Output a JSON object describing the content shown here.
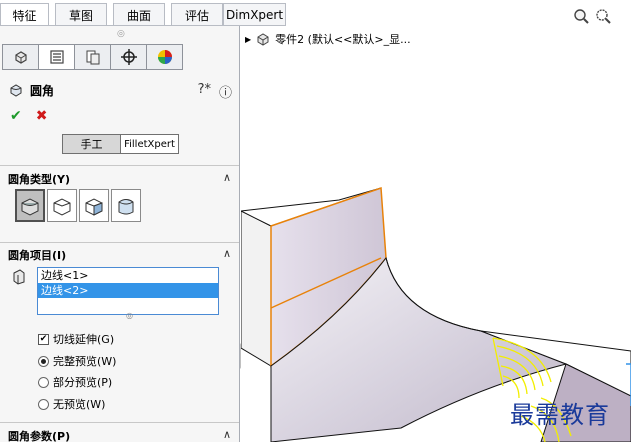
{
  "top_tabs": [
    "特征",
    "草图",
    "曲面",
    "评估",
    "DimXpert"
  ],
  "manager_tabs": [
    {
      "icon": "feature-manager-icon"
    },
    {
      "icon": "property-manager-icon"
    },
    {
      "icon": "configuration-manager-icon"
    },
    {
      "icon": "dimxpert-manager-icon"
    },
    {
      "icon": "display-manager-icon"
    }
  ],
  "pm": {
    "title": "圆角",
    "help_icons": [
      "detailed-help-icon",
      "help-icon"
    ]
  },
  "mode": {
    "manual": "手工",
    "xpert": "FilletXpert"
  },
  "sections": {
    "fillet_type": "圆角类型(Y)",
    "fillet_items": "圆角项目(I)",
    "fillet_params": "圆角参数(P)"
  },
  "edges": [
    "边线<1>",
    "边线<2>"
  ],
  "selected_edge_index": 1,
  "tangent": {
    "label": "切线延伸(G)",
    "checked": true
  },
  "preview": {
    "options": [
      "完整预览(W)",
      "部分预览(P)",
      "无预览(W)"
    ],
    "selected": 0
  },
  "tree": {
    "label": "零件2 (默认<<默认>_显..."
  },
  "watermark": "最需教育",
  "colors": {
    "accent_blue": "#3394e8",
    "ok_green": "#1e9a2a",
    "cancel_red": "#d01a1a",
    "edge_orange": "#e8820a",
    "preview_yellow": "#f2ee00"
  }
}
